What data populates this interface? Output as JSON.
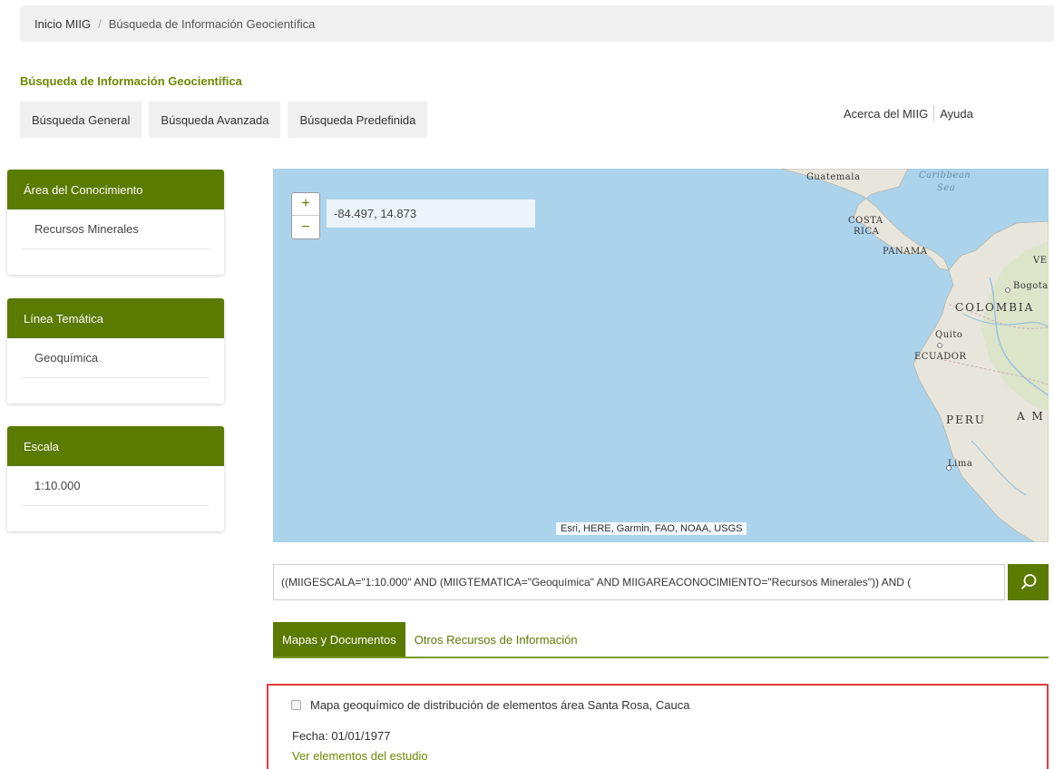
{
  "breadcrumb": {
    "home": "Inicio MIIG",
    "separator": "/",
    "current": "Búsqueda de Información Geocientífica"
  },
  "page_title": "Búsqueda de Información Geocientífica",
  "search_tabs": [
    {
      "label": "Búsqueda General"
    },
    {
      "label": "Búsqueda Avanzada"
    },
    {
      "label": "Búsqueda Predefinida"
    }
  ],
  "top_links": {
    "about": "Acerca del MIIG",
    "help": "Ayuda"
  },
  "facets": [
    {
      "title": "Área del Conocimiento",
      "value": "Recursos Minerales"
    },
    {
      "title": "Línea Temática",
      "value": "Geoquímica"
    },
    {
      "title": "Escala",
      "value": "1:10.000"
    }
  ],
  "map": {
    "zoom_in": "+",
    "zoom_out": "−",
    "coordinates": "-84.497, 14.873",
    "attribution": "Esri, HERE, Garmin, FAO, NOAA, USGS",
    "labels": {
      "guatemala": "Guatemala",
      "caribbean": "Caribbean",
      "sea": "Sea",
      "costa": "COSTA",
      "rica": "RICA",
      "panama": "PANAMA",
      "ve": "VE",
      "bogota": "Bogota",
      "colombia": "COLOMBIA",
      "quito": "Quito",
      "ecuador": "ECUADOR",
      "peru": "PERU",
      "am": "A M",
      "lima": "Lima"
    },
    "colors": {
      "ocean": "#abd3ec",
      "land": "#e8e6dc",
      "river": "#9cc3dc"
    }
  },
  "search": {
    "query": "((MIIGESCALA=\"1:10.000\" AND (MIIGTEMATICA=\"Geoquímica\" AND MIIGAREACONOCIMIENTO=\"Recursos Minerales\")) AND (",
    "button_icon": "search-icon"
  },
  "result_tabs": {
    "active": "Mapas y Documentos",
    "other": "Otros Recursos de Información"
  },
  "results": [
    {
      "title": "Mapa geoquímico de distribución de elementos área Santa Rosa, Cauca",
      "date": "Fecha: 01/01/1977",
      "link": "Ver elementos del estudio"
    }
  ],
  "theme": {
    "accent": "#5a7a00",
    "highlight_border": "#e03c3c"
  }
}
